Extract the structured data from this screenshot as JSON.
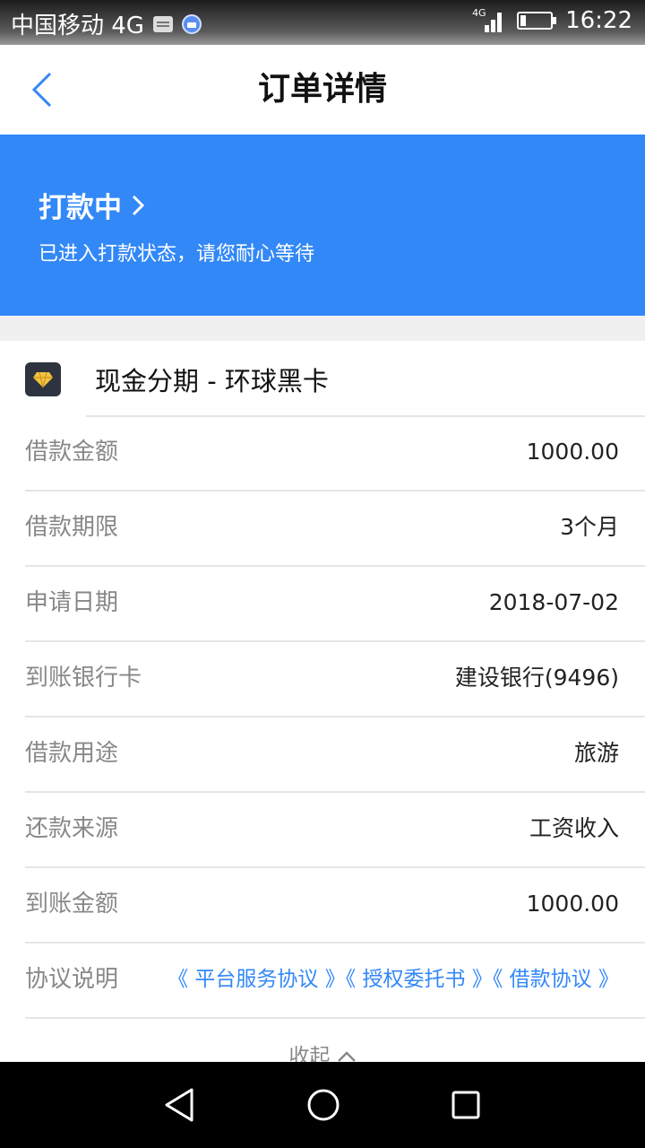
{
  "status_bar": {
    "carrier": "中国移动 4G",
    "network": "4G",
    "time": "16:22",
    "icons": [
      "message-icon",
      "app-notification-icon",
      "signal-icon",
      "battery-icon"
    ]
  },
  "nav": {
    "title": "订单详情",
    "back_icon": "chevron-left-icon"
  },
  "banner": {
    "status_title": "打款中",
    "status_subtitle": "已进入打款状态，请您耐心等待",
    "background_color": "#3388f7",
    "chevron_icon": "chevron-right-icon"
  },
  "product": {
    "name": "现金分期 - 环球黑卡",
    "logo_icon": "diamond-icon"
  },
  "details": [
    {
      "label": "借款金额",
      "value": "1000.00"
    },
    {
      "label": "借款期限",
      "value": "3个月"
    },
    {
      "label": "申请日期",
      "value": "2018-07-02"
    },
    {
      "label": "到账银行卡",
      "value": "建设银行(9496)"
    },
    {
      "label": "借款用途",
      "value": "旅游"
    },
    {
      "label": "还款来源",
      "value": "工资收入"
    },
    {
      "label": "到账金额",
      "value": "1000.00"
    }
  ],
  "agreements": {
    "label": "协议说明",
    "links": [
      "《 平台服务协议 》",
      "《 授权委托书 》",
      "《 借款协议 》"
    ],
    "link_color": "#3388f7"
  },
  "collapse": {
    "label": "收起"
  },
  "system_nav": {
    "icons": [
      "back-triangle-icon",
      "home-circle-icon",
      "recents-square-icon"
    ]
  }
}
